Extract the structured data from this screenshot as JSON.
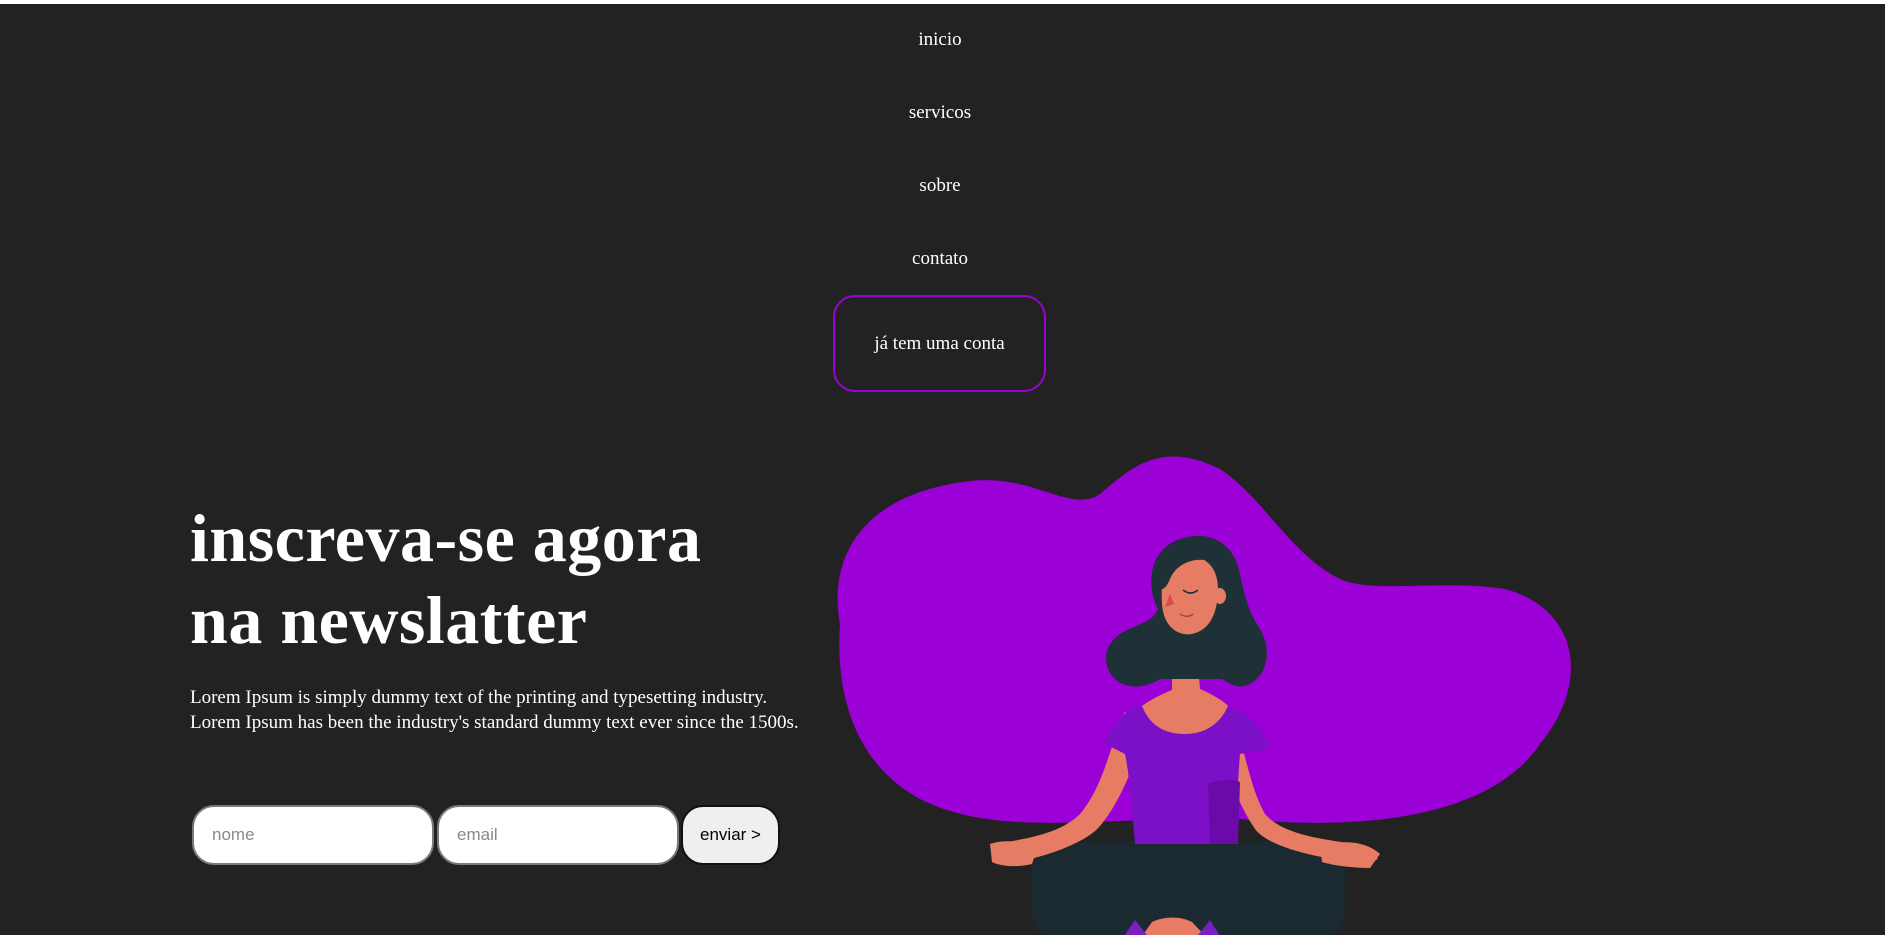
{
  "nav": {
    "items": [
      {
        "label": "inicio"
      },
      {
        "label": "servicos"
      },
      {
        "label": "sobre"
      },
      {
        "label": "contato"
      }
    ],
    "account_label": "já tem uma conta",
    "account_border_color": "#9b00d6"
  },
  "hero": {
    "title_line1": "inscreva-se agora",
    "title_line2": "na newslatter",
    "description": "Lorem Ipsum is simply dummy text of the printing and typesetting industry. Lorem Ipsum has been the industry's standard dummy text ever since the 1500s."
  },
  "form": {
    "name_placeholder": "nome",
    "email_placeholder": "email",
    "name_value": "",
    "email_value": "",
    "submit_label": "enviar >"
  },
  "illustration": {
    "icon": "meditating-woman-illustration",
    "blob_color": "#9b00d6",
    "background_color": "#222222"
  }
}
